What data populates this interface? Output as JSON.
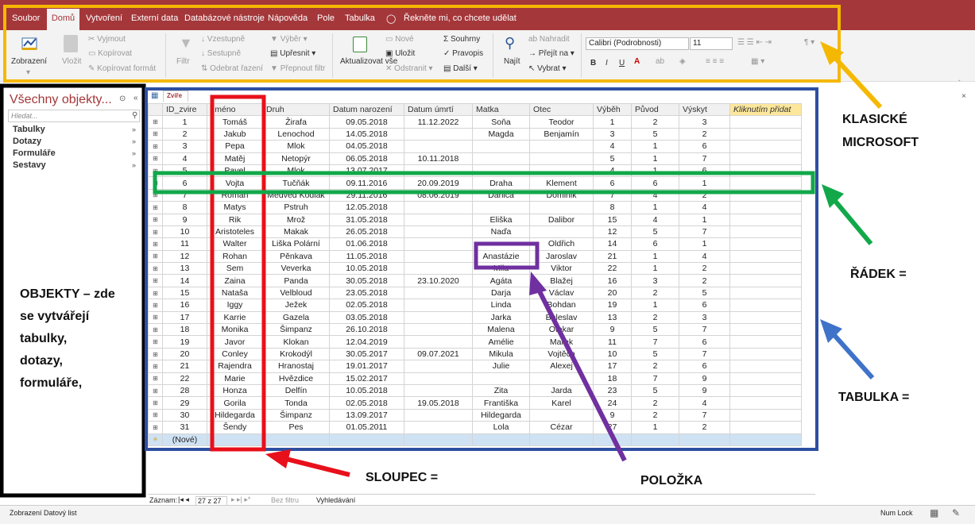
{
  "menu": {
    "tabs": [
      "Soubor",
      "Domů",
      "Vytvoření",
      "Externí data",
      "Databázové nástroje",
      "Nápověda",
      "Pole",
      "Tabulka"
    ],
    "active_tab": "Domů",
    "tell_me": "Řekněte mi, co chcete udělat"
  },
  "ribbon": {
    "view": "Zobrazení",
    "paste": "Vložit",
    "cut": "Vyjmout",
    "copy": "Kopírovat",
    "format_painter": "Kopírovat formát",
    "filter": "Filtr",
    "ascending": "Vzestupně",
    "descending": "Sestupně",
    "remove_sort": "Odebrat řazení",
    "selection": "Výběr",
    "advanced": "Upřesnit",
    "toggle_filter": "Přepnout filtr",
    "refresh": "Aktualizovat vše",
    "new": "Nové",
    "save": "Uložit",
    "delete": "Odstranit",
    "totals": "Souhrny",
    "spelling": "Pravopis",
    "more": "Další",
    "find": "Najít",
    "replace": "Nahradit",
    "goto": "Přejít na",
    "select": "Vybrat",
    "font": "Calibri (Podrobnosti)",
    "size": "11",
    "bold": "B",
    "italic": "I",
    "underline": "U"
  },
  "nav": {
    "title": "Všechny objekty...",
    "search_placeholder": "Hledat...",
    "items": [
      "Tabulky",
      "Dotazy",
      "Formuláře",
      "Sestavy"
    ]
  },
  "doc_tab": "Zvíře",
  "table": {
    "columns": [
      "ID_zvire",
      "Jméno",
      "Druh",
      "Datum narození",
      "Datum úmrtí",
      "Matka",
      "Otec",
      "Výběh",
      "Původ",
      "Výskyt",
      "Kliknutím přidat"
    ],
    "rows": [
      [
        "1",
        "Tomáš",
        "Žirafa",
        "09.05.2018",
        "11.12.2022",
        "Soňa",
        "Teodor",
        "1",
        "2",
        "3"
      ],
      [
        "2",
        "Jakub",
        "Lenochod",
        "14.05.2018",
        "",
        "Magda",
        "Benjamín",
        "3",
        "5",
        "2"
      ],
      [
        "3",
        "Pepa",
        "Mlok",
        "04.05.2018",
        "",
        "",
        "",
        "4",
        "1",
        "6"
      ],
      [
        "4",
        "Matěj",
        "Netopýr",
        "06.05.2018",
        "10.11.2018",
        "",
        "",
        "5",
        "1",
        "7"
      ],
      [
        "5",
        "Pavel",
        "Mlok",
        "13.07.2017",
        "",
        "",
        "",
        "4",
        "1",
        "6"
      ],
      [
        "6",
        "Vojta",
        "Tučňák",
        "09.11.2016",
        "20.09.2019",
        "Draha",
        "Klement",
        "6",
        "6",
        "1"
      ],
      [
        "7",
        "Roman",
        "Medvěd Kodiak",
        "29.11.2016",
        "08.06.2019",
        "Danica",
        "Dominik",
        "7",
        "4",
        "2"
      ],
      [
        "8",
        "Matys",
        "Pstruh",
        "12.05.2018",
        "",
        "",
        "",
        "8",
        "1",
        "4"
      ],
      [
        "9",
        "Rik",
        "Mrož",
        "31.05.2018",
        "",
        "Eliška",
        "Dalibor",
        "15",
        "4",
        "1"
      ],
      [
        "10",
        "Aristoteles",
        "Makak",
        "26.05.2018",
        "",
        "Naďa",
        "",
        "12",
        "5",
        "7"
      ],
      [
        "11",
        "Walter",
        "Liška Polární",
        "01.06.2018",
        "",
        "",
        "Oldřich",
        "14",
        "6",
        "1"
      ],
      [
        "12",
        "Rohan",
        "Pěnkava",
        "11.05.2018",
        "",
        "Anastázie",
        "Jaroslav",
        "21",
        "1",
        "4"
      ],
      [
        "13",
        "Sem",
        "Veverka",
        "10.05.2018",
        "",
        "Mila",
        "Viktor",
        "22",
        "1",
        "2"
      ],
      [
        "14",
        "Zaina",
        "Panda",
        "30.05.2018",
        "23.10.2020",
        "Agáta",
        "Blažej",
        "16",
        "3",
        "2"
      ],
      [
        "15",
        "Nataša",
        "Velbloud",
        "23.05.2018",
        "",
        "Darja",
        "Václav",
        "20",
        "2",
        "5"
      ],
      [
        "16",
        "Iggy",
        "Ježek",
        "02.05.2018",
        "",
        "Linda",
        "Bohdan",
        "19",
        "1",
        "6"
      ],
      [
        "17",
        "Karrie",
        "Gazela",
        "03.05.2018",
        "",
        "Jarka",
        "Boleslav",
        "13",
        "2",
        "3"
      ],
      [
        "18",
        "Monika",
        "Šimpanz",
        "26.10.2018",
        "",
        "Malena",
        "Otakar",
        "9",
        "5",
        "7"
      ],
      [
        "19",
        "Javor",
        "Klokan",
        "12.04.2019",
        "",
        "Amélie",
        "Marek",
        "11",
        "7",
        "6"
      ],
      [
        "20",
        "Conley",
        "Krokodýl",
        "30.05.2017",
        "09.07.2021",
        "Mikula",
        "Vojtěch",
        "10",
        "5",
        "7"
      ],
      [
        "21",
        "Rajendra",
        "Hranostaj",
        "19.01.2017",
        "",
        "Julie",
        "Alexej",
        "17",
        "2",
        "6"
      ],
      [
        "22",
        "Marie",
        "Hvězdice",
        "15.02.2017",
        "",
        "",
        "",
        "18",
        "7",
        "9"
      ],
      [
        "28",
        "Honza",
        "Delfín",
        "10.05.2018",
        "",
        "Zita",
        "Jarda",
        "23",
        "5",
        "9"
      ],
      [
        "29",
        "Gorila",
        "Tonda",
        "02.05.2018",
        "19.05.2018",
        "Františka",
        "Karel",
        "24",
        "2",
        "4"
      ],
      [
        "30",
        "Hildegarda",
        "Šimpanz",
        "13.09.2017",
        "",
        "Hildegarda",
        "",
        "9",
        "2",
        "7"
      ],
      [
        "31",
        "Šendy",
        "Pes",
        "01.05.2011",
        "",
        "Lola",
        "Cézar",
        "27",
        "1",
        "2"
      ]
    ],
    "new_row": "(Nové)"
  },
  "record_nav": {
    "label": "Záznam:",
    "position": "27 z 27",
    "no_filter": "Bez filtru",
    "search": "Vyhledávání"
  },
  "status": {
    "left": "Zobrazení Datový list",
    "numlock": "Num Lock"
  },
  "annotations": {
    "klasicke": "KLASICKÉ",
    "microsoft": "MICROSOFT",
    "radek": "ŘÁDEK =",
    "tabulka": "TABULKA =",
    "polozka": "POLOŽKA",
    "sloupec": "SLOUPEC =",
    "objekty": [
      "OBJEKTY – zde",
      "se vytvářejí",
      "tabulky,",
      "dotazy,",
      "formuláře,"
    ]
  },
  "colors": {
    "accent": "#a4373a",
    "yellow": "#f5b800",
    "green": "#12a84a",
    "blue": "#2e4fa1",
    "purple": "#7030a0",
    "red": "#e8101a",
    "black": "#000000"
  }
}
